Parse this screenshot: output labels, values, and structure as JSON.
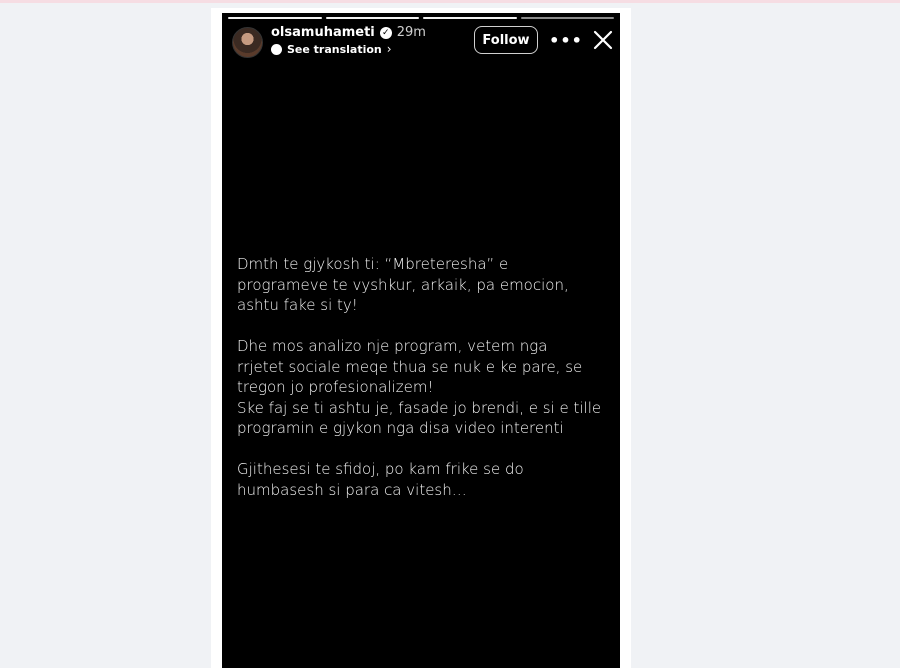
{
  "story": {
    "username": "olsamuhameti",
    "time_ago": "29m",
    "see_translation": "See translation",
    "follow_label": "Follow",
    "more_label": "•••",
    "progress_segments": [
      true,
      true,
      true,
      false
    ],
    "paragraphs": [
      "Dmth te gjykosh ti: “Mbreteresha” e\nprogrameve te vyshkur, arkaik, pa emocion,\nashtu fake si ty!",
      "Dhe mos analizo nje program, vetem nga\nrrjetet sociale meqe thua se nuk e ke pare, se\ntregon jo profesionalizem!\nSke faj se ti ashtu je, fasade jo brendi, e si e tille\nprogramin e  gjykon nga disa video interenti",
      "Gjithesesi te sfidoj, po kam frike se do\nhumbasesh si para ca vitesh…"
    ]
  },
  "colors": {
    "page_bg": "#f0f2f5",
    "story_bg": "#000000",
    "text": "#f4f4f4"
  },
  "icons": {
    "verified": "verified-badge-icon",
    "translate": "translate-icon",
    "more": "more-options-icon",
    "close": "close-icon"
  }
}
